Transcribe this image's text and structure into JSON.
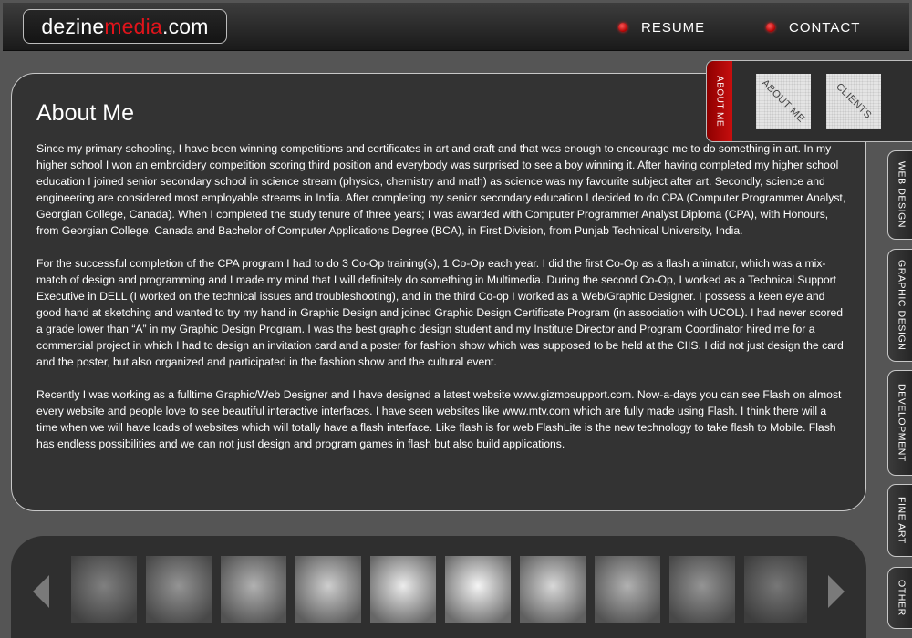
{
  "header": {
    "logo": {
      "part1": "dezine",
      "part2": "media",
      "part3": ".com"
    },
    "nav": [
      {
        "label": "RESUME"
      },
      {
        "label": "CONTACT"
      }
    ]
  },
  "content": {
    "title": "About Me",
    "paragraphs": [
      "Since my primary schooling, I have been winning competitions and certificates in art and craft and that was enough to encourage me to do something in art. In my higher school I won an embroidery competition scoring third position and everybody was surprised to see a boy winning it. After having completed my higher school education I joined senior secondary school in science stream (physics, chemistry and math) as science was my favourite subject after art. Secondly, science and engineering are considered most employable streams in India. After completing my senior secondary education I decided to do CPA (Computer Programmer Analyst, Georgian College, Canada). When I completed the study tenure of three years; I was awarded with Computer Programmer Analyst Diploma (CPA), with Honours, from Georgian College, Canada and Bachelor of Computer Applications Degree (BCA), in First Division, from Punjab Technical University, India.",
      "For the successful completion of the CPA program I had to do 3 Co-Op training(s), 1 Co-Op each year. I did the first Co-Op as a flash animator, which was a mix-match of design and programming and I made my mind that I will definitely do something in Multimedia. During the second Co-Op, I worked as a Technical Support Executive in DELL (I worked on the technical issues and troubleshooting), and in the third Co-op I worked as a Web/Graphic Designer. I possess a keen eye and good hand at sketching and wanted to try my hand in Graphic Design and joined Graphic Design Certificate Program (in association with UCOL). I had never scored a grade lower than “A” in my Graphic Design Program. I was the best graphic design student and my Institute Director and Program Coordinator hired me for a commercial project in which I had to design an invitation card and a poster for fashion show which was supposed to be held at the CIIS. I did not just design the card and the poster, but also organized and participated in the fashion show and the cultural event.",
      "Recently I was working as a fulltime Graphic/Web Designer and I have designed a latest website www.gizmosupport.com. Now-a-days you can see Flash on almost every website and people love to see beautiful interactive interfaces. I have seen websites like www.mtv.com which are fully made using Flash. I think there will a time when we will have loads of websites which will totally have a flash interface. Like flash is for web FlashLite is the new technology to take flash to Mobile. Flash has endless possibilities and we can not just design and program games in flash but also build applications."
    ]
  },
  "tabs": {
    "active": "ABOUT ME",
    "thumbs": [
      "ABOUT ME",
      "CLIENTS"
    ]
  },
  "side_nav": [
    "WEB DESIGN",
    "GRAPHIC DESIGN",
    "DEVELOPMENT",
    "FINE ART",
    "OTHER"
  ],
  "gallery": {
    "brightness": [
      0.35,
      0.45,
      0.6,
      0.75,
      0.9,
      0.95,
      0.8,
      0.6,
      0.45,
      0.3
    ]
  },
  "colors": {
    "accent": "#e0141b",
    "panel": "#333333",
    "background": "#555555"
  }
}
